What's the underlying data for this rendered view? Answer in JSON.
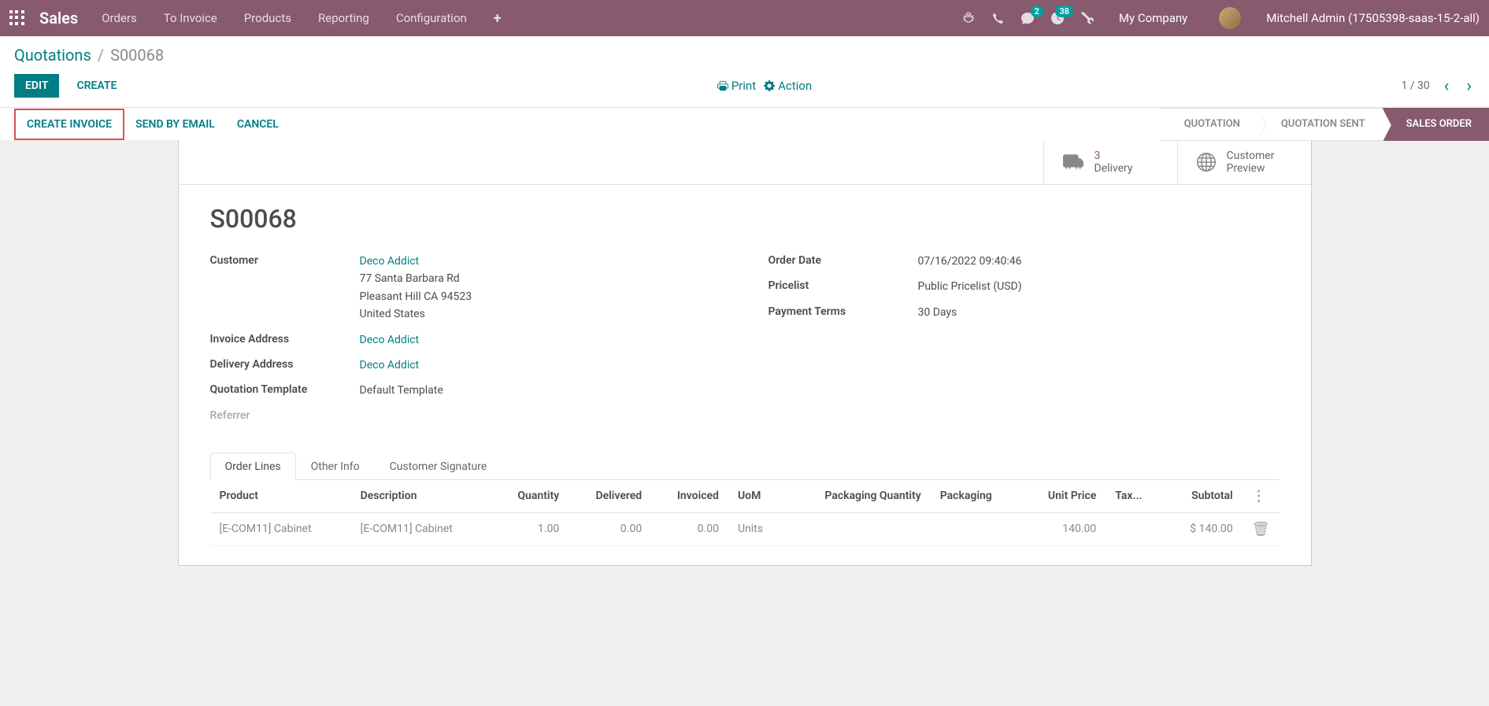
{
  "topbar": {
    "brand": "Sales",
    "nav": [
      "Orders",
      "To Invoice",
      "Products",
      "Reporting",
      "Configuration"
    ],
    "messaging_badge": "2",
    "activities_badge": "38",
    "company": "My Company",
    "user": "Mitchell Admin (17505398-saas-15-2-all)"
  },
  "breadcrumb": {
    "parent": "Quotations",
    "current": "S00068"
  },
  "controlpanel": {
    "edit": "EDIT",
    "create": "CREATE",
    "print": "Print",
    "action": "Action",
    "pager": "1 / 30"
  },
  "statusbar": {
    "create_invoice": "CREATE INVOICE",
    "send_email": "SEND BY EMAIL",
    "cancel": "CANCEL",
    "steps": [
      "QUOTATION",
      "QUOTATION SENT",
      "SALES ORDER"
    ]
  },
  "stat_buttons": {
    "delivery_count": "3",
    "delivery_label": "Delivery",
    "preview_line1": "Customer",
    "preview_line2": "Preview"
  },
  "record": {
    "name": "S00068",
    "labels": {
      "customer": "Customer",
      "invoice_address": "Invoice Address",
      "delivery_address": "Delivery Address",
      "quotation_template": "Quotation Template",
      "referrer": "Referrer",
      "order_date": "Order Date",
      "pricelist": "Pricelist",
      "payment_terms": "Payment Terms"
    },
    "customer_name": "Deco Addict",
    "customer_addr1": "77 Santa Barbara Rd",
    "customer_addr2": "Pleasant Hill CA 94523",
    "customer_addr3": "United States",
    "invoice_address": "Deco Addict",
    "delivery_address": "Deco Addict",
    "quotation_template": "Default Template",
    "order_date": "07/16/2022 09:40:46",
    "pricelist": "Public Pricelist (USD)",
    "payment_terms": "30 Days"
  },
  "tabs": [
    "Order Lines",
    "Other Info",
    "Customer Signature"
  ],
  "table": {
    "headers": {
      "product": "Product",
      "description": "Description",
      "quantity": "Quantity",
      "delivered": "Delivered",
      "invoiced": "Invoiced",
      "uom": "UoM",
      "packaging_qty": "Packaging Quantity",
      "packaging": "Packaging",
      "unit_price": "Unit Price",
      "taxes": "Tax...",
      "subtotal": "Subtotal"
    },
    "row": {
      "product": "[E-COM11] Cabinet",
      "description": "[E-COM11] Cabinet",
      "quantity": "1.00",
      "delivered": "0.00",
      "invoiced": "0.00",
      "uom": "Units",
      "unit_price": "140.00",
      "subtotal": "$ 140.00"
    }
  }
}
